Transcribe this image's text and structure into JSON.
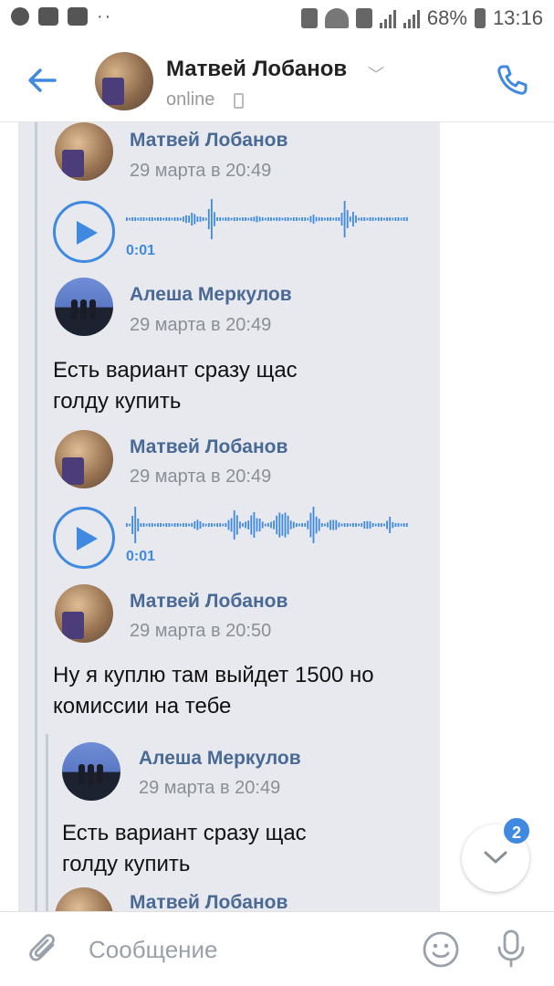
{
  "status_bar": {
    "battery": "68%",
    "time": "13:16"
  },
  "header": {
    "name": "Матвей Лобанов",
    "status": "online"
  },
  "messages": [
    {
      "author": "Матвей Лобанов",
      "date": "29 марта в 20:49",
      "type": "voice",
      "duration": "0:01"
    },
    {
      "author": "Алеша Меркулов",
      "date": "29 марта в 20:49",
      "type": "text",
      "text_line1": "Есть вариант сразу щас",
      "text_line2": "голду купить"
    },
    {
      "author": "Матвей Лобанов",
      "date": "29 марта в 20:49",
      "type": "voice",
      "duration": "0:01"
    },
    {
      "author": "Матвей Лобанов",
      "date": "29 марта в 20:50",
      "type": "text",
      "text_line1": "Ну я куплю там выйдет 1500 но",
      "text_line2": "комиссии на тебе"
    },
    {
      "author": "Алеша Меркулов",
      "date": "29 марта в 20:49",
      "type": "text",
      "text_line1": "Есть вариант сразу щас",
      "text_line2": "голду купить"
    },
    {
      "author": "Матвей Лобанов"
    }
  ],
  "unread_badge": "2",
  "composer": {
    "placeholder": "Сообщение"
  },
  "colors": {
    "accent": "#3f8ae0",
    "author_name": "#4a6a96",
    "bubble_bg": "#e7e9ee"
  }
}
